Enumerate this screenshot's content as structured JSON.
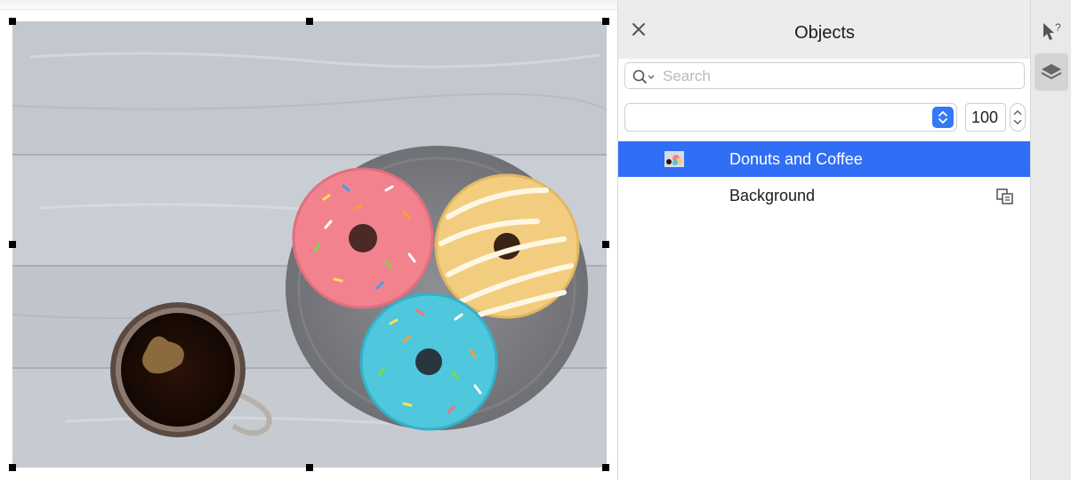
{
  "canvas": {
    "object_name": "Donuts and Coffee"
  },
  "docker": {
    "title": "Objects",
    "search": {
      "placeholder": "Search",
      "value": ""
    },
    "layer_select_value": "",
    "opacity": "100",
    "rows": [
      {
        "label": "Donuts and Coffee",
        "selected": true,
        "icon": "image-thumbnail-icon"
      },
      {
        "label": "Background",
        "selected": false,
        "icon": "layer-properties-icon"
      }
    ]
  },
  "side_tabs": [
    {
      "icon": "hints-icon"
    },
    {
      "icon": "objects-layers-icon",
      "active": true
    }
  ],
  "colors": {
    "selection": "#2f6ef5",
    "accent": "#3478f6",
    "panel_header": "#ececec"
  }
}
